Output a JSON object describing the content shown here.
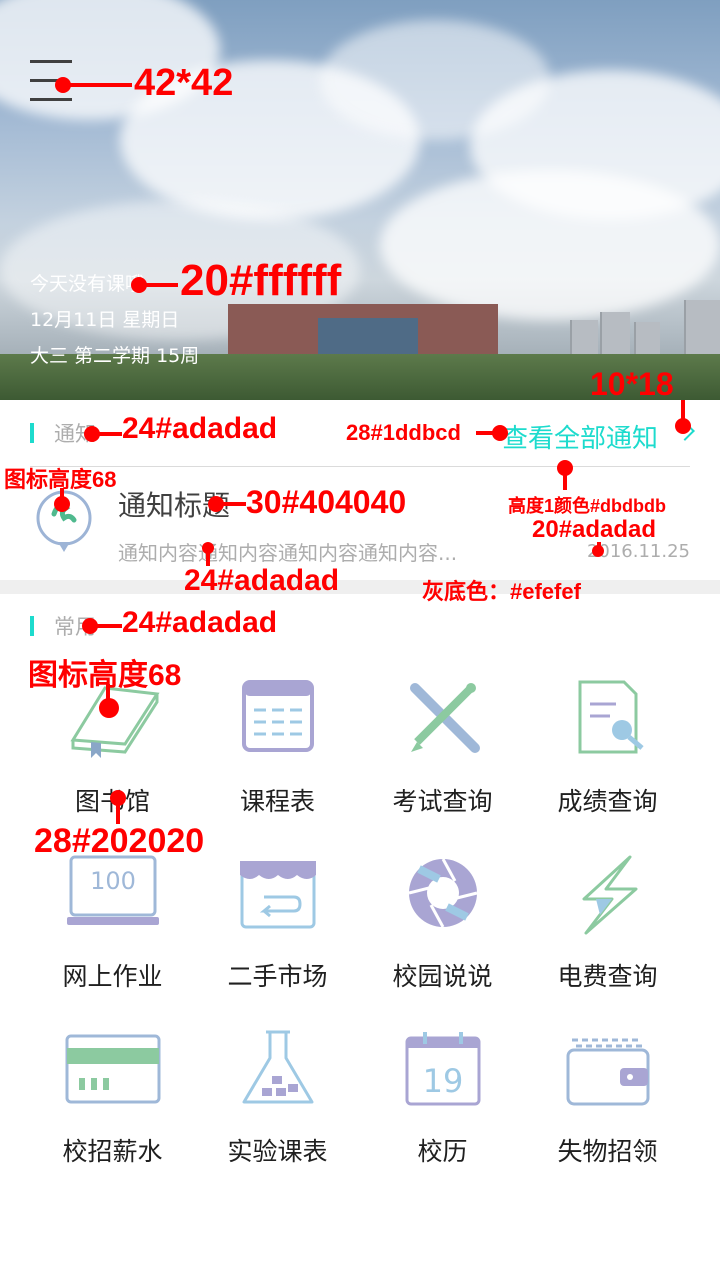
{
  "hero": {
    "today_text": "今天没有课哦",
    "date_text": "12月11日 星期日",
    "term_text": "大三 第二学期 15周"
  },
  "notice": {
    "section_label": "通知",
    "view_all": "查看全部通知",
    "title": "通知标题",
    "body": "通知内容通知内容通知内容通知内容...",
    "date": "2016.11.25"
  },
  "common": {
    "section_label": "常用",
    "items": [
      {
        "label": "图书馆",
        "icon": "book-icon"
      },
      {
        "label": "课程表",
        "icon": "timetable-icon"
      },
      {
        "label": "考试查询",
        "icon": "exam-icon"
      },
      {
        "label": "成绩查询",
        "icon": "grades-icon"
      },
      {
        "label": "网上作业",
        "icon": "homework-icon"
      },
      {
        "label": "二手市场",
        "icon": "market-icon"
      },
      {
        "label": "校园说说",
        "icon": "aperture-icon"
      },
      {
        "label": "电费查询",
        "icon": "lightning-icon"
      },
      {
        "label": "校招薪水",
        "icon": "card-icon"
      },
      {
        "label": "实验课表",
        "icon": "flask-icon"
      },
      {
        "label": "校历",
        "icon": "calendar-icon"
      },
      {
        "label": "失物招领",
        "icon": "wallet-icon"
      }
    ]
  },
  "annotations": {
    "menu_size": "42*42",
    "hero_text_spec": "20#ffffff",
    "arrow_size": "10*18",
    "notice_label_spec": "24#adadad",
    "view_all_spec": "28#1ddbcd",
    "icon_height_small": "图标高度68",
    "notice_title_spec": "30#404040",
    "divider_spec": "高度1颜色#dbdbdb",
    "date_spec": "20#adadad",
    "notice_body_spec": "24#adadad",
    "gray_spec": "灰底色：#efefef",
    "common_label_spec": "24#adadad",
    "icon_height_large": "图标高度68",
    "grid_label_spec": "28#202020"
  },
  "colors": {
    "accent": "#1ddbcd",
    "muted": "#adadad",
    "title": "#404040",
    "text": "#202020",
    "divider": "#dbdbdb",
    "band": "#efefef"
  }
}
